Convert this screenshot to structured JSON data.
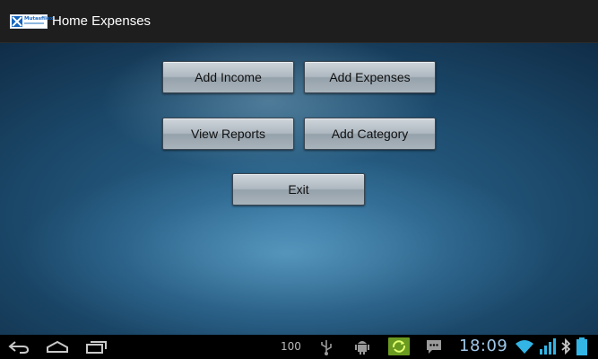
{
  "app": {
    "title": "Home Expenses",
    "logo_text": "Mutasfilex"
  },
  "buttons": {
    "add_income": "Add Income",
    "add_expenses": "Add Expenses",
    "view_reports": "View Reports",
    "add_category": "Add Category",
    "exit": "Exit"
  },
  "status_bar": {
    "battery_level": "100",
    "time": "18:09",
    "icons": [
      "back-icon",
      "home-icon",
      "recent-apps-icon",
      "usb-icon",
      "android-debug-icon",
      "sync-icon",
      "message-icon",
      "wifi-icon",
      "signal-icon",
      "bluetooth-icon",
      "battery-icon"
    ]
  },
  "colors": {
    "action_bar": "#1e1e1e",
    "clock": "#9fc7e8",
    "system_icon": "#33b5e5"
  }
}
